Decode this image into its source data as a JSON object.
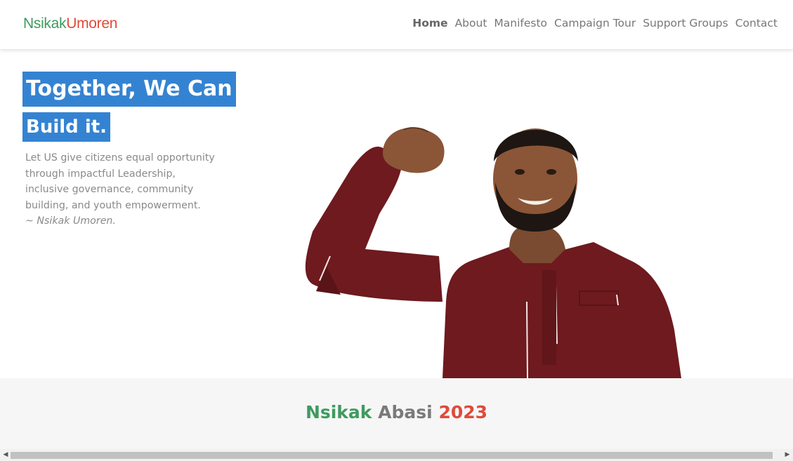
{
  "colors": {
    "green": "#3e9b5f",
    "red": "#e04a3a",
    "blue": "#3483d2"
  },
  "brand": {
    "first": "Nsikak",
    "last": "Umoren"
  },
  "nav": {
    "items": [
      {
        "label": "Home",
        "active": true
      },
      {
        "label": "About"
      },
      {
        "label": "Manifesto"
      },
      {
        "label": "Campaign Tour"
      },
      {
        "label": "Support Groups"
      },
      {
        "label": "Contact"
      }
    ]
  },
  "hero": {
    "headline_line1": "Together, We Can",
    "headline_line2": "Build it.",
    "tagline": "Let US give citizens equal opportunity through impactful Leadership, inclusive governance, community building, and youth empowerment.",
    "signature": "~ Nsikak Umoren."
  },
  "band": {
    "word1": "Nsikak",
    "word2": "Abasi",
    "word3": "2023"
  },
  "scrollbar": {
    "left_arrow": "◀",
    "right_arrow": "▶"
  }
}
